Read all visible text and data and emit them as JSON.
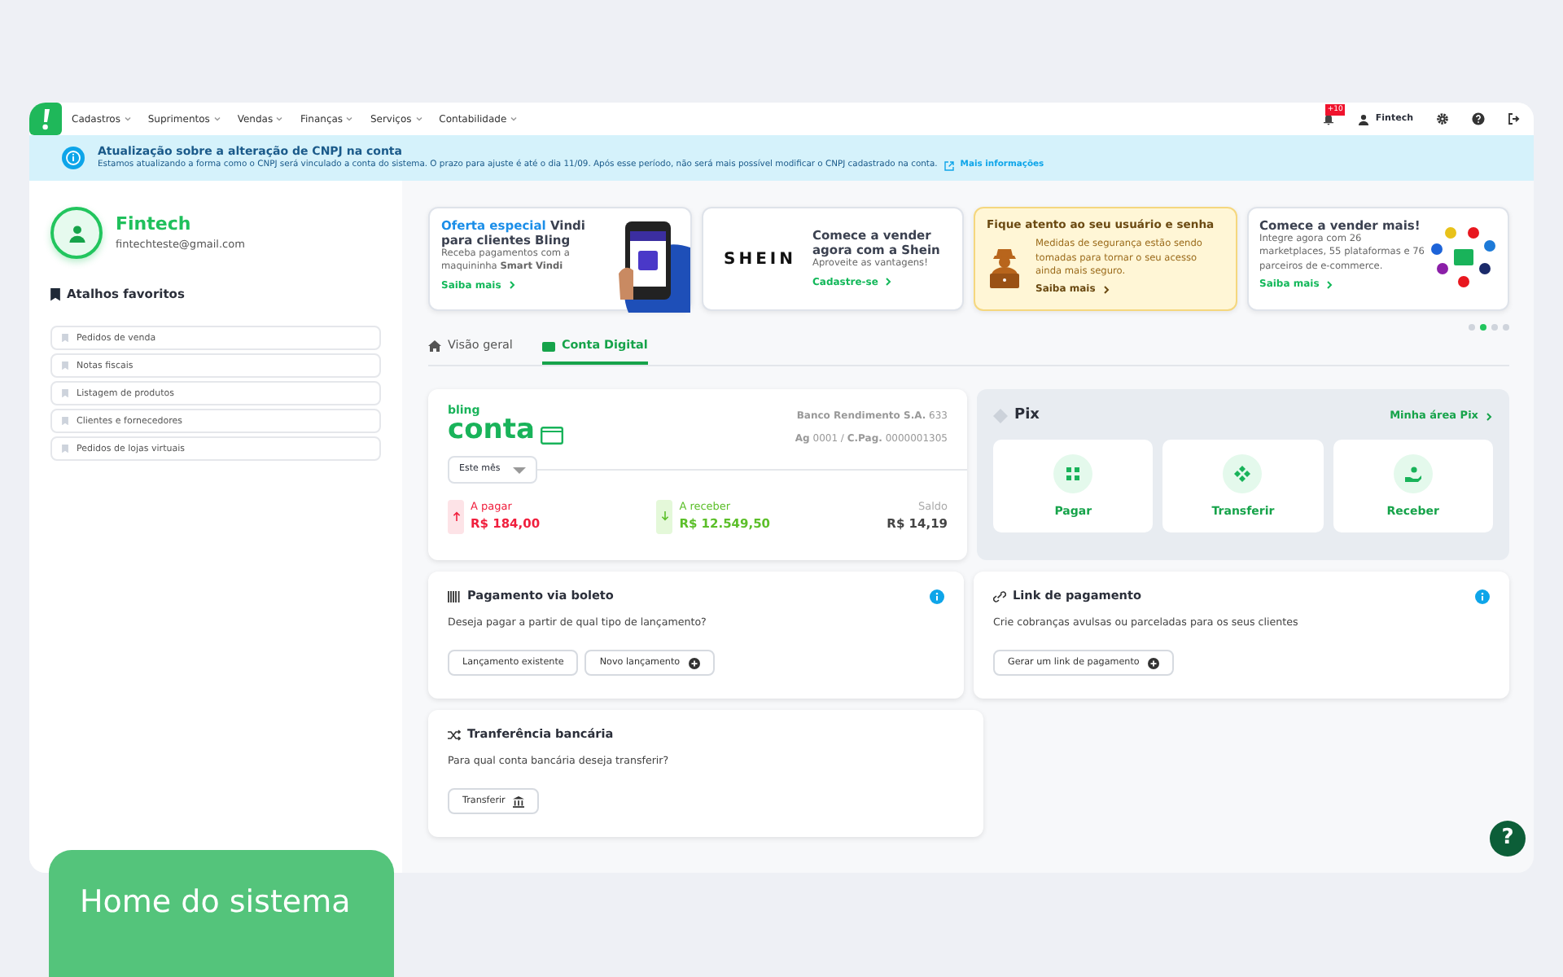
{
  "nav": {
    "menus": [
      "Cadastros",
      "Suprimentos",
      "Vendas",
      "Finanças",
      "Serviços",
      "Contabilidade"
    ],
    "notification_badge": "+10",
    "user": "Fintech"
  },
  "alert": {
    "title": "Atualização sobre a alteração de CNPJ na conta",
    "message": "Estamos atualizando a forma como o CNPJ será vinculado a conta do sistema. O prazo para ajuste é até o dia 11/09. Após esse período, não será mais possível modificar o CNPJ cadastrado na conta.",
    "link": "Mais informações"
  },
  "profile": {
    "name": "Fintech",
    "email": "fintechteste@gmail.com"
  },
  "favorites": {
    "title": "Atalhos favoritos",
    "items": [
      "Pedidos de venda",
      "Notas fiscais",
      "Listagem de produtos",
      "Clientes e fornecedores",
      "Pedidos de lojas virtuais"
    ]
  },
  "banners": [
    {
      "kind": "vindi",
      "highlight": "Oferta especial",
      "title": "Vindi para clientes Bling",
      "text": "Receba pagamentos com a maquininha **Smart Vindi**",
      "link": "Saiba mais"
    },
    {
      "kind": "shein",
      "logo": "SHEIN",
      "title": "Comece a vender agora com a Shein",
      "text": "Aproveite as vantagens!",
      "link": "Cadastre-se"
    },
    {
      "kind": "warning",
      "title": "Fique atento ao seu usuário e senha",
      "text": "Medidas de segurança estão sendo tomadas para tornar o seu acesso ainda mais seguro.",
      "link": "Saiba mais"
    },
    {
      "kind": "integrations",
      "title": "Comece a vender mais!",
      "text": "Integre agora com 26 marketplaces, 55 plataformas e 76 parceiros de e-commerce.",
      "link": "Saiba mais"
    }
  ],
  "carousel_dots": [
    {
      "selected": false
    },
    {
      "selected": true
    },
    {
      "selected": false
    },
    {
      "selected": false
    }
  ],
  "tabs": [
    {
      "kind": "home",
      "label": "Visão geral",
      "selected": false
    },
    {
      "kind": "wallet",
      "label": "Conta Digital",
      "selected": true
    }
  ],
  "account": {
    "logo_top": "bling",
    "logo_main": "conta",
    "bank": "**Banco Rendimento S.A.** 633",
    "agency": "**Ag** 0001 / **C.Pag.** 0000001305",
    "period": "Este mês",
    "summary": [
      {
        "kind": "payable",
        "label": "A pagar",
        "amount": "R$ 184,00"
      },
      {
        "kind": "receivable",
        "label": "A receber",
        "amount": "R$ 12.549,50"
      },
      {
        "kind": "balance",
        "label": "Saldo",
        "amount": "R$ 14,19"
      }
    ]
  },
  "pix": {
    "title": "Pix",
    "link": "Minha área Pix",
    "actions": [
      {
        "kind": "pay",
        "label": "Pagar"
      },
      {
        "kind": "transfer",
        "label": "Transferir"
      },
      {
        "kind": "receive",
        "label": "Receber"
      }
    ]
  },
  "cards": [
    {
      "kind": "boleto",
      "title": "Pagamento via boleto",
      "text": "Deseja pagar a partir de qual tipo de lançamento?",
      "info": true,
      "buttons": [
        {
          "label": "Lançamento existente",
          "kind": "plain"
        },
        {
          "label": "Novo lançamento",
          "kind": "add"
        }
      ]
    },
    {
      "kind": "link",
      "title": "Link de pagamento",
      "text": "Crie cobranças avulsas ou parceladas para os seus clientes",
      "info": true,
      "buttons": [
        {
          "label": "Gerar um link de pagamento",
          "kind": "add"
        }
      ]
    },
    {
      "kind": "transfer",
      "title": "Tranferência bancária",
      "text": "Para qual conta bancária deseja transferir?",
      "info": false,
      "buttons": [
        {
          "label": "Transferir",
          "kind": "bank"
        }
      ]
    }
  ],
  "help_button": "?",
  "caption": "Home do sistema"
}
